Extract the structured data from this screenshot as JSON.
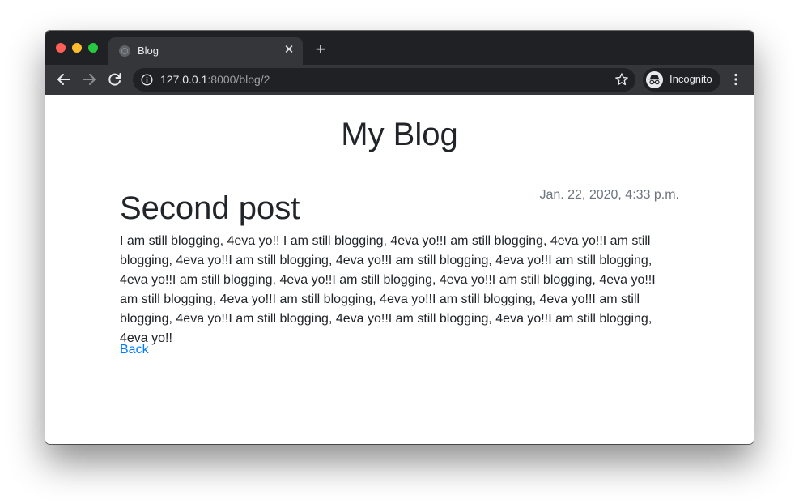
{
  "browser": {
    "tab": {
      "title": "Blog"
    },
    "address": {
      "host": "127.0.0.1",
      "rest": ":8000/blog/2"
    },
    "incognito_label": "Incognito"
  },
  "page": {
    "site_title": "My Blog",
    "post": {
      "title": "Second post",
      "date": "Jan. 22, 2020, 4:33 p.m.",
      "body": "I am still blogging, 4eva yo!! I am still blogging, 4eva yo!!I am still blogging, 4eva yo!!I am still blogging, 4eva yo!!I am still blogging, 4eva yo!!I am still blogging, 4eva yo!!I am still blogging, 4eva yo!!I am still blogging, 4eva yo!!I am still blogging, 4eva yo!!I am still blogging, 4eva yo!!I am still blogging, 4eva yo!!I am still blogging, 4eva yo!!I am still blogging, 4eva yo!!I am still blogging, 4eva yo!!I am still blogging, 4eva yo!!I am still blogging, 4eva yo!!I am still blogging, 4eva yo!!"
    },
    "back_link": "Back"
  },
  "colors": {
    "tabstrip": "#202124",
    "toolbar": "#35363a",
    "link": "#007bff",
    "muted_text": "#6c757d",
    "text": "#212529"
  },
  "icons": [
    "close-window-icon",
    "minimize-window-icon",
    "maximize-window-icon",
    "globe-favicon-icon",
    "close-tab-icon",
    "plus-icon",
    "back-arrow-icon",
    "forward-arrow-icon",
    "reload-icon",
    "info-icon",
    "star-icon",
    "incognito-icon",
    "more-vert-icon"
  ]
}
